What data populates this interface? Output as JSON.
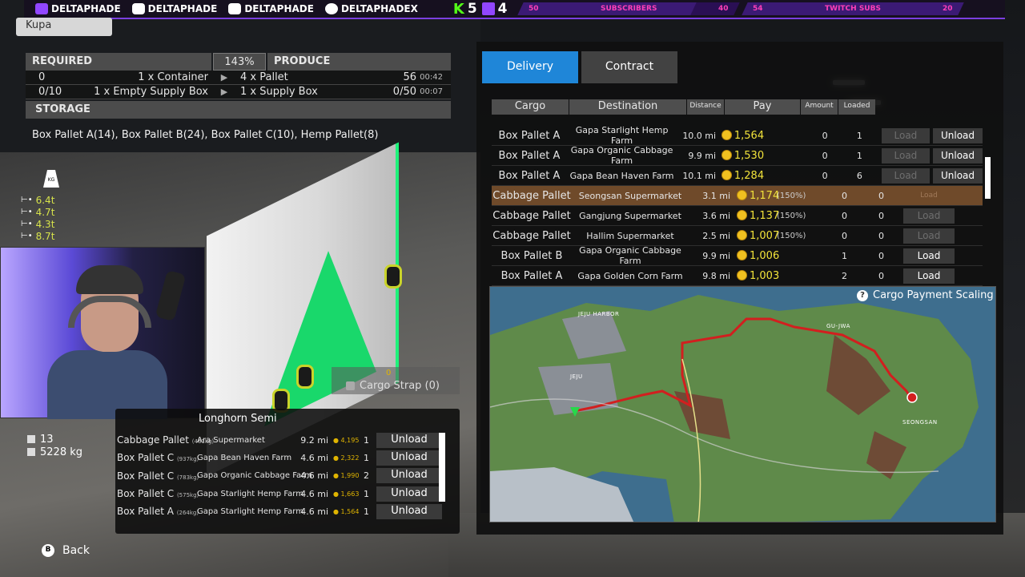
{
  "banner": {
    "socials": [
      "DELTAPHADE",
      "DELTAPHADE",
      "DELTAPHADE",
      "DELTAPHADEX"
    ],
    "kick_label": "K",
    "kick_count": "5",
    "twitch_count": "4",
    "goal1": {
      "left": "50",
      "label": "SUBSCRIBERS",
      "right": "40",
      "progress": 0.8
    },
    "goal2": {
      "left": "54",
      "label": "TWITCH SUBS",
      "right": "20",
      "progress": 1.0
    }
  },
  "location_chip": "Kupa",
  "production": {
    "required_header": "REQUIRED",
    "percent": "143%",
    "produce_header": "PRODUCE",
    "rows": [
      {
        "req_amount": "0",
        "req_item": "1 x Container",
        "prod_item": "4 x Pallet",
        "prod_amount": "56",
        "time": "00:42"
      },
      {
        "req_amount": "0/10",
        "req_item": "1 x Empty Supply Box",
        "prod_item": "1 x Supply Box",
        "prod_amount": "0/50",
        "time": "00:07"
      }
    ],
    "storage_header": "STORAGE",
    "storage_text": "Box Pallet A(14), Box Pallet B(24), Box Pallet C(10), Hemp Pallet(8)"
  },
  "weights": {
    "kg_label": "KG",
    "values": [
      "6.4t",
      "4.7t",
      "4.3t",
      "8.7t"
    ]
  },
  "cargo_strap": {
    "coin": "0",
    "label": "Cargo Strap (0)"
  },
  "vehicle": {
    "name": "Longhorn Semi",
    "count": "13",
    "weight": "5228 kg",
    "rows": [
      {
        "cargo": "Cabbage Pallet",
        "kg": "(461kg)",
        "dest": "Ara Supermarket",
        "dist": "9.2 mi",
        "pay": "4,195",
        "amount": "1",
        "btn": "Unload"
      },
      {
        "cargo": "Box Pallet C",
        "kg": "(937kg)",
        "dest": "Gapa Bean Haven Farm",
        "dist": "4.6 mi",
        "pay": "2,322",
        "amount": "1",
        "btn": "Unload"
      },
      {
        "cargo": "Box Pallet C",
        "kg": "(783kg)",
        "dest": "Gapa Organic Cabbage Farm",
        "dist": "4.6 mi",
        "pay": "1,990",
        "amount": "2",
        "btn": "Unload"
      },
      {
        "cargo": "Box Pallet C",
        "kg": "(575kg)",
        "dest": "Gapa Starlight Hemp Farm",
        "dist": "4.6 mi",
        "pay": "1,663",
        "amount": "1",
        "btn": "Unload"
      },
      {
        "cargo": "Box Pallet A",
        "kg": "(264kg)",
        "dest": "Gapa Starlight Hemp Farm",
        "dist": "4.6 mi",
        "pay": "1,564",
        "amount": "1",
        "btn": "Unload"
      }
    ]
  },
  "back": {
    "key": "B",
    "label": "Back"
  },
  "tabs": {
    "delivery": "Delivery",
    "contract": "Contract"
  },
  "cargo_table": {
    "headers": {
      "cargo": "Cargo",
      "destination": "Destination",
      "distance": "Distance",
      "pay": "Pay",
      "amount": "Amount",
      "loaded": "Loaded"
    },
    "rows": [
      {
        "cargo": "Box Pallet A",
        "dest": "Gapa Starlight Hemp Farm",
        "dist": "10.0 mi",
        "pay": "1,564",
        "pct": "",
        "amount": "0",
        "loaded": "1",
        "load": "Load",
        "unload": "Unload"
      },
      {
        "cargo": "Box Pallet A",
        "dest": "Gapa Organic Cabbage Farm",
        "dist": "9.9 mi",
        "pay": "1,530",
        "pct": "",
        "amount": "0",
        "loaded": "1",
        "load": "Load",
        "unload": "Unload"
      },
      {
        "cargo": "Box Pallet A",
        "dest": "Gapa Bean Haven Farm",
        "dist": "10.1 mi",
        "pay": "1,284",
        "pct": "",
        "amount": "0",
        "loaded": "6",
        "load": "Load",
        "unload": "Unload"
      },
      {
        "cargo": "Cabbage Pallet",
        "dest": "Seongsan Supermarket",
        "dist": "3.1 mi",
        "pay": "1,174",
        "pct": "(150%)",
        "amount": "0",
        "loaded": "0",
        "load": "Load",
        "unload": ""
      },
      {
        "cargo": "Cabbage Pallet",
        "dest": "Gangjung Supermarket",
        "dist": "3.6 mi",
        "pay": "1,137",
        "pct": "(150%)",
        "amount": "0",
        "loaded": "0",
        "load": "Load",
        "unload": ""
      },
      {
        "cargo": "Cabbage Pallet",
        "dest": "Hallim Supermarket",
        "dist": "2.5 mi",
        "pay": "1,007",
        "pct": "(150%)",
        "amount": "0",
        "loaded": "0",
        "load": "Load",
        "unload": ""
      },
      {
        "cargo": "Box Pallet B",
        "dest": "Gapa Organic Cabbage Farm",
        "dist": "9.9 mi",
        "pay": "1,006",
        "pct": "",
        "amount": "1",
        "loaded": "0",
        "load": "Load",
        "unload": ""
      },
      {
        "cargo": "Box Pallet A",
        "dest": "Gapa Golden Corn Farm",
        "dist": "9.8 mi",
        "pay": "1,003",
        "pct": "",
        "amount": "2",
        "loaded": "0",
        "load": "Load",
        "unload": ""
      }
    ]
  },
  "map": {
    "scaling_label": "Cargo Payment Scaling",
    "labels": [
      "JEJU HARBOR",
      "JEJU",
      "GU-JWA",
      "SEONGSAN"
    ],
    "colors": {
      "sea": "#3e6e8e",
      "land": "#5f8a4a",
      "route": "#d21f1f",
      "player": "#27d84a"
    }
  }
}
